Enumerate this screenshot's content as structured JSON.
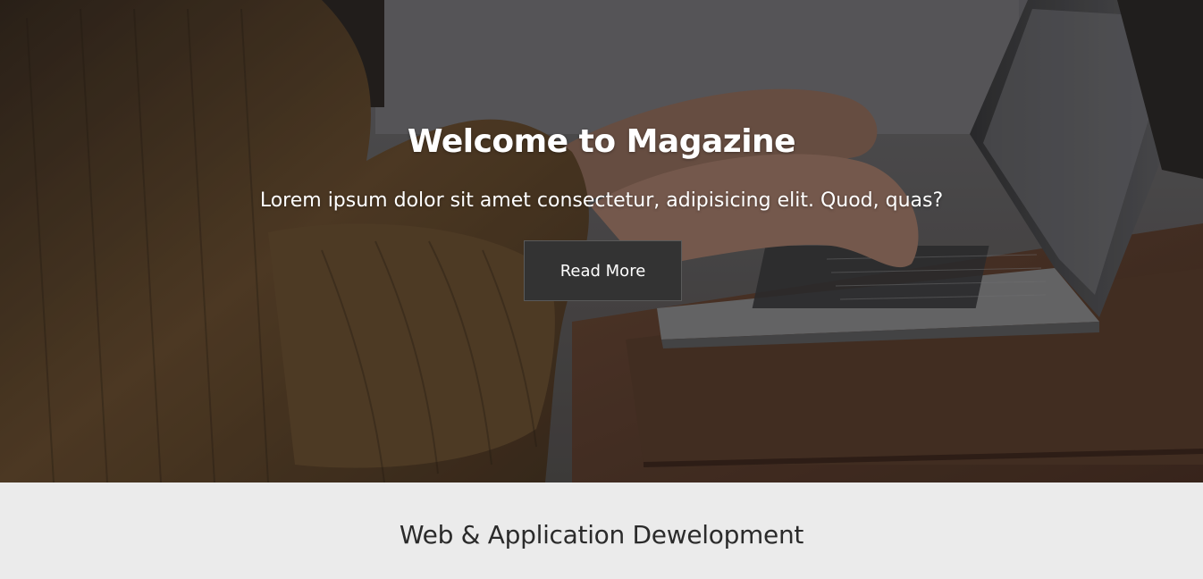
{
  "hero": {
    "title": "Welcome to Magazine",
    "subtitle": "Lorem ipsum dolor sit amet consectetur, adipisicing elit. Quod, quas?",
    "button_label": "Read More",
    "image": "person-typing-on-laptop-photo"
  },
  "section": {
    "title": "Web & Application Dewelopment"
  },
  "colors": {
    "button_bg": "#333333",
    "section_bg": "#ebebeb",
    "section_text": "#2b2b2b",
    "hero_text": "#ffffff"
  }
}
